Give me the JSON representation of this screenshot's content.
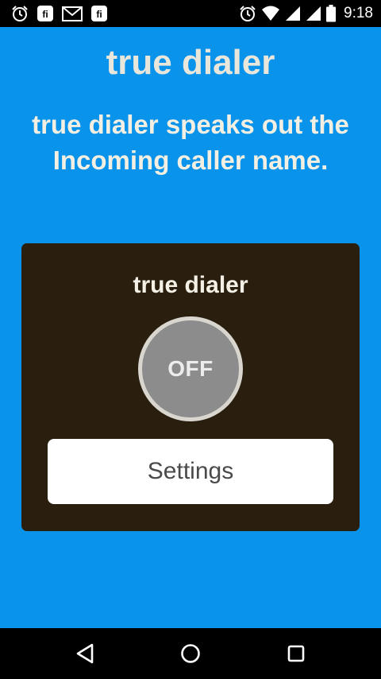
{
  "status_bar": {
    "time": "9:18",
    "left_icons": [
      "alarm-icon",
      "fi-icon",
      "gmail-icon",
      "fi-icon"
    ],
    "right_icons": [
      "alarm-icon",
      "wifi-icon",
      "signal-icon",
      "signal-icon",
      "battery-icon"
    ]
  },
  "header": {
    "title": "true dialer",
    "description": "true dialer speaks out the Incoming caller name."
  },
  "card": {
    "title": "true dialer",
    "toggle_label": "OFF",
    "settings_label": "Settings"
  },
  "nav_bar": {
    "buttons": [
      "back-icon",
      "home-icon",
      "recents-icon"
    ]
  },
  "colors": {
    "background": "#0a93ea",
    "card": "#2a1f0f",
    "toggle": "#8c8c8c",
    "text_light": "#f3efe2"
  }
}
